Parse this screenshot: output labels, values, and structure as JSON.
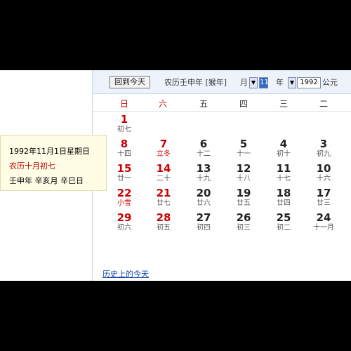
{
  "toolbar": {
    "today_button": "回到今天",
    "lunar_year_label": "农历壬申年 [猴年]",
    "month_label": "月",
    "month_value": "11",
    "year_label": "年",
    "year_value": "1992",
    "era_label": "公元"
  },
  "weekdays": [
    "日",
    "六",
    "五",
    "四",
    "三",
    "二"
  ],
  "weeks": [
    [
      {
        "day": "1",
        "lunar": "初七",
        "red": true
      }
    ],
    [
      {
        "day": "8",
        "lunar": "十四",
        "red": true
      },
      {
        "day": "7",
        "lunar": "立冬",
        "red": true,
        "festival": true
      },
      {
        "day": "6",
        "lunar": "十二"
      },
      {
        "day": "5",
        "lunar": "十一"
      },
      {
        "day": "4",
        "lunar": "初十"
      },
      {
        "day": "3",
        "lunar": "初九"
      }
    ],
    [
      {
        "day": "15",
        "lunar": "廿一",
        "red": true
      },
      {
        "day": "14",
        "lunar": "二十",
        "red": true
      },
      {
        "day": "13",
        "lunar": "十九"
      },
      {
        "day": "12",
        "lunar": "十八"
      },
      {
        "day": "11",
        "lunar": "十七"
      },
      {
        "day": "10",
        "lunar": "十六"
      }
    ],
    [
      {
        "day": "22",
        "lunar": "小雪",
        "red": true,
        "festival": true
      },
      {
        "day": "21",
        "lunar": "廿七",
        "red": true
      },
      {
        "day": "20",
        "lunar": "廿六"
      },
      {
        "day": "19",
        "lunar": "廿五"
      },
      {
        "day": "18",
        "lunar": "廿四"
      },
      {
        "day": "17",
        "lunar": "廿三"
      }
    ],
    [
      {
        "day": "29",
        "lunar": "初六",
        "red": true
      },
      {
        "day": "28",
        "lunar": "初五",
        "red": true
      },
      {
        "day": "27",
        "lunar": "初四"
      },
      {
        "day": "26",
        "lunar": "初三"
      },
      {
        "day": "25",
        "lunar": "初二"
      },
      {
        "day": "24",
        "lunar": "十一月"
      }
    ]
  ],
  "history_link": "历史上的今天",
  "detail": {
    "date": "1992年11月1日星期日",
    "lunar": "农历十月初七",
    "ganzhi": "壬申年 辛亥月 辛巳日"
  },
  "colors": {
    "accent_red": "#cc0000",
    "link_blue": "#0b3fa8",
    "toolbar_bg": "#eef3fb",
    "popup_bg": "#fffde6"
  }
}
